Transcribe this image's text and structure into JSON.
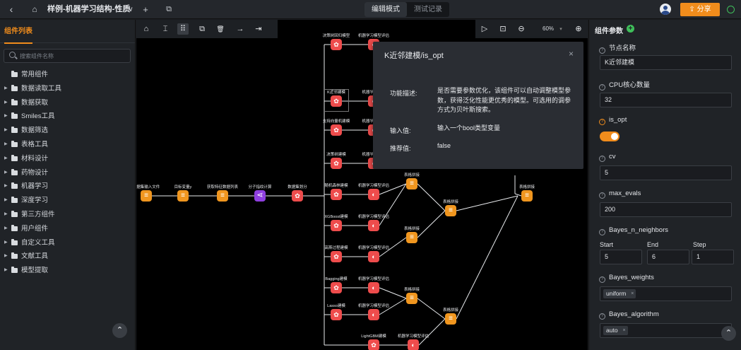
{
  "header": {
    "back": "‹",
    "home": "⌂",
    "title": "样例-机器学习结构-性质",
    "dropdown": "∨",
    "add": "+",
    "copy": "⧉",
    "mode_edit": "编辑模式",
    "mode_test": "测试记录",
    "share": "分享"
  },
  "left": {
    "title": "组件列表",
    "search_placeholder": "搜索组件名称",
    "items": [
      {
        "label": "常用组件",
        "arrow": ""
      },
      {
        "label": "数据读取工具",
        "arrow": "▶"
      },
      {
        "label": "数据获取",
        "arrow": "▶"
      },
      {
        "label": "Smiles工具",
        "arrow": "▶"
      },
      {
        "label": "数据筛选",
        "arrow": "▶"
      },
      {
        "label": "表格工具",
        "arrow": "▶"
      },
      {
        "label": "材料设计",
        "arrow": "▶"
      },
      {
        "label": "药物设计",
        "arrow": "▶"
      },
      {
        "label": "机器学习",
        "arrow": "▶"
      },
      {
        "label": "深度学习",
        "arrow": "▶"
      },
      {
        "label": "第三方组件",
        "arrow": "▶"
      },
      {
        "label": "用户组件",
        "arrow": "▶"
      },
      {
        "label": "自定义工具",
        "arrow": "▶"
      },
      {
        "label": "文献工具",
        "arrow": "▶"
      },
      {
        "label": "模型提取",
        "arrow": "▶"
      }
    ],
    "collapse": "⌃"
  },
  "canvas": {
    "tools": [
      "⌂",
      "⌶",
      "⠿",
      "⧉",
      "🗑",
      "→",
      "⇥"
    ],
    "right_tools": [
      "▷",
      "⊡",
      "⊖"
    ],
    "zoom": "60%",
    "zoom_caret": "▾",
    "zoom_in": "⊕",
    "nodes": [
      {
        "label": "数据集输入文件",
        "kind": "o"
      },
      {
        "label": "目标变量y",
        "kind": "o"
      },
      {
        "label": "获取特征数据列表",
        "kind": "o"
      },
      {
        "label": "分子指纹计算",
        "kind": "p"
      },
      {
        "label": "数据集划分",
        "kind": "r"
      },
      {
        "label": "决策树回归模型",
        "kind": "r"
      },
      {
        "label": "机器学习模型评估",
        "kind": "rm"
      },
      {
        "label": "K近邻建模",
        "kind": "r"
      },
      {
        "label": "机器学习模型",
        "kind": "rm"
      },
      {
        "label": "支持向量机建模",
        "kind": "r"
      },
      {
        "label": "机器学习模型",
        "kind": "rm"
      },
      {
        "label": "决策树建模",
        "kind": "r"
      },
      {
        "label": "机器学习模型",
        "kind": "rm"
      },
      {
        "label": "随机森林建模",
        "kind": "r"
      },
      {
        "label": "机器学习模型评估",
        "kind": "rm"
      },
      {
        "label": "XGBoost建模",
        "kind": "r"
      },
      {
        "label": "机器学习模型评估",
        "kind": "rm"
      },
      {
        "label": "高斯过程建模",
        "kind": "r"
      },
      {
        "label": "机器学习模型评估",
        "kind": "rm"
      },
      {
        "label": "Bagging建模",
        "kind": "r"
      },
      {
        "label": "机器学习模型评估",
        "kind": "rm"
      },
      {
        "label": "Lasso建模",
        "kind": "r"
      },
      {
        "label": "机器学习模型评估",
        "kind": "rm"
      },
      {
        "label": "LightGBM建模",
        "kind": "r"
      },
      {
        "label": "机器学习模型评估",
        "kind": "rm"
      },
      {
        "label": "表格拼接",
        "kind": "o"
      },
      {
        "label": "表格拼接",
        "kind": "o"
      },
      {
        "label": "表格拼接",
        "kind": "o"
      },
      {
        "label": "表格拼接",
        "kind": "o"
      },
      {
        "label": "表格拼接",
        "kind": "o"
      },
      {
        "label": "表格拼接",
        "kind": "o"
      }
    ]
  },
  "popup": {
    "title": "K近邻建模/is_opt",
    "close": "×",
    "desc_key": "功能描述:",
    "desc_val": "是否需要参数优化，该组件可以自动调整模型参数，获得泛化性能更优秀的模型。可选用的调参方式为贝叶斯搜索。",
    "input_key": "输入值:",
    "input_val": "输入一个bool类型变量",
    "rec_key": "推荐值:",
    "rec_val": "false"
  },
  "right": {
    "title": "组件参数",
    "plus": "+",
    "params": {
      "node_name_label": "节点名称",
      "node_name_value": "K近邻建模",
      "cpu_label": "CPU核心数量",
      "cpu_value": "32",
      "is_opt_label": "is_opt",
      "is_opt_value": true,
      "cv_label": "cv",
      "cv_value": "5",
      "max_evals_label": "max_evals",
      "max_evals_value": "200",
      "bayes_n_label": "Bayes_n_neighbors",
      "start_label": "Start",
      "start_value": "5",
      "end_label": "End",
      "end_value": "6",
      "step_label": "Step",
      "step_value": "1",
      "bayes_weights_label": "Bayes_weights",
      "bayes_weights_tag": "uniform",
      "bayes_algorithm_label": "Bayes_algorithm",
      "bayes_algorithm_tag": "auto",
      "tag_remove": "×"
    },
    "collapse": "⌃"
  },
  "colors": {
    "accent": "#f08c1c",
    "ok": "#3fbf5a",
    "node_red": "#ee4c4c",
    "node_purple": "#8f3fe0",
    "node_orange": "#f0961f"
  }
}
